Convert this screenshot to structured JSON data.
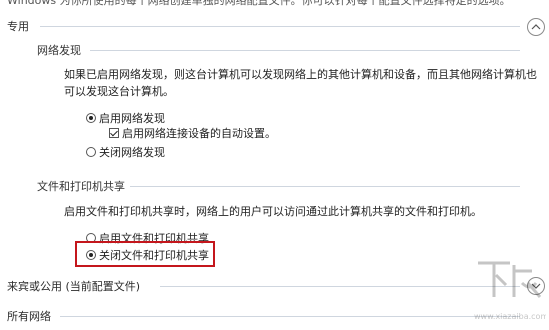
{
  "page": {
    "top_text": "Windows 为你所使用的每个网络创建单独的网络配置文件。你可以针对每个配置文件选择特定的选项。"
  },
  "private_section": {
    "title": "专用",
    "network_discovery": {
      "heading": "网络发现",
      "description_line1": "如果已启用网络发现，则这台计算机可以发现网络上的其他计算机和设备，而且其他网络计算机也",
      "description_line2": "可以发现这台计算机。",
      "opt_on": "启用网络发现",
      "opt_on_checked": true,
      "auto_setup": "启用网络连接设备的自动设置。",
      "auto_setup_checked": true,
      "opt_off": "关闭网络发现",
      "opt_off_checked": false
    },
    "file_printer_sharing": {
      "heading": "文件和打印机共享",
      "description": "启用文件和打印机共享时，网络上的用户可以访问通过此计算机共享的文件和打印机。",
      "opt_on": "启用文件和打印机共享",
      "opt_on_checked": false,
      "opt_off": "关闭文件和打印机共享",
      "opt_off_checked": true
    }
  },
  "guest_public_section": {
    "title": "来宾或公用 (当前配置文件)"
  },
  "all_networks_section": {
    "title": "所有网络"
  },
  "watermark": {
    "text": "下载吧",
    "url": "www.xiazaiba.com"
  },
  "colors": {
    "highlight_border": "#c4161c",
    "separator": "#cfd6df"
  }
}
